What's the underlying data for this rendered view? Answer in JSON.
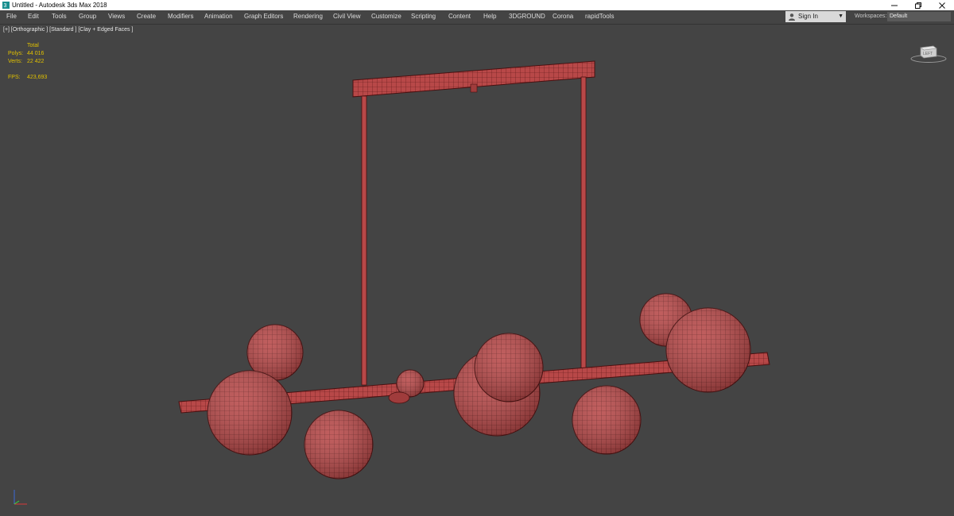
{
  "window": {
    "title": "Untitled - Autodesk 3ds Max 2018"
  },
  "menu": [
    "File",
    "Edit",
    "Tools",
    "Group",
    "Views",
    "Create",
    "Modifiers",
    "Animation",
    "Graph Editors",
    "Rendering",
    "Civil View",
    "Customize",
    "Scripting",
    "Content",
    "Help",
    "3DGROUND",
    "Corona",
    "rapidTools"
  ],
  "signin": {
    "label": "Sign In"
  },
  "workspaces": {
    "label": "Workspaces:",
    "value": "Default"
  },
  "viewport": {
    "label": "[+] [Orthographic ] [Standard ] [Clay + Edged Faces ]",
    "stats": {
      "header": "Total",
      "polys_label": "Polys:",
      "polys": "44 016",
      "verts_label": "Verts:",
      "verts": "22 422",
      "fps_label": "FPS:",
      "fps": "423,693"
    },
    "viewcube_label": "LEFT"
  },
  "colors": {
    "background": "#444444",
    "model_fill": "#b84848",
    "wire": "#5a1616",
    "stats_text": "#e0c000"
  },
  "icons": [
    "3ds-max-icon",
    "minimize-icon",
    "restore-icon",
    "close-icon",
    "user-icon",
    "dropdown-arrow-icon",
    "viewcube-icon",
    "axis-tripod-icon"
  ]
}
